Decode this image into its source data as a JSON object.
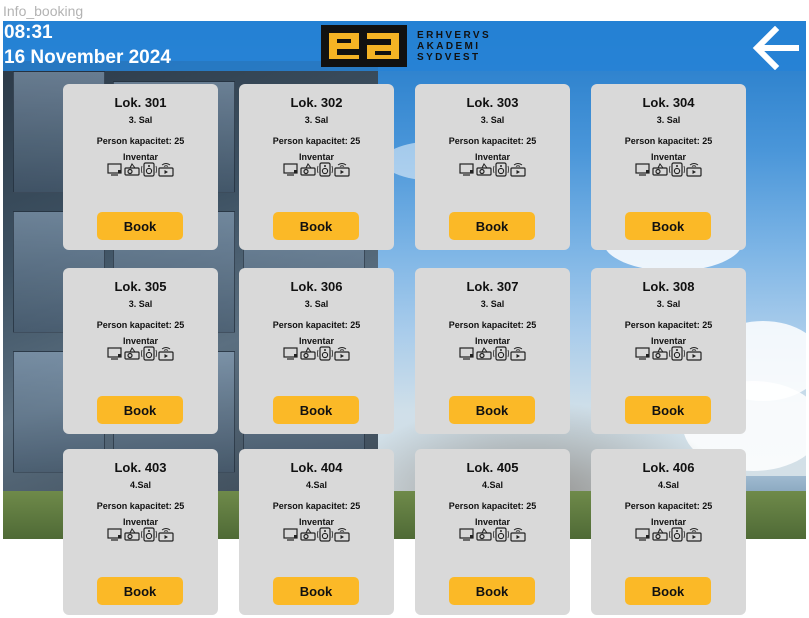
{
  "frame_label": "Info_booking",
  "header": {
    "time": "08:31",
    "date": "16 November 2024",
    "logo": {
      "mark": "ea",
      "lines": [
        "ERHVERVS",
        "AKADEMI",
        "SYDVEST"
      ]
    },
    "back_icon": "arrow-left-icon"
  },
  "colors": {
    "header_bar": "#2682d6",
    "card_background": "#d9d9d9",
    "book_button": "#fbb927",
    "logo_accent": "#f5b324"
  },
  "inventory_icons": [
    "screen-icon",
    "projector-icon",
    "speaker-icon",
    "camera-icon"
  ],
  "rooms": [
    {
      "name": "Lok. 301",
      "floor": "3. Sal",
      "capacity": "Person kapacitet: 25",
      "inventory_label": "Inventar",
      "button": "Book"
    },
    {
      "name": "Lok. 302",
      "floor": "3. Sal",
      "capacity": "Person kapacitet: 25",
      "inventory_label": "Inventar",
      "button": "Book"
    },
    {
      "name": "Lok. 303",
      "floor": "3. Sal",
      "capacity": "Person kapacitet: 25",
      "inventory_label": "Inventar",
      "button": "Book"
    },
    {
      "name": "Lok. 304",
      "floor": "3. Sal",
      "capacity": "Person kapacitet: 25",
      "inventory_label": "Inventar",
      "button": "Book"
    },
    {
      "name": "Lok. 305",
      "floor": "3. Sal",
      "capacity": "Person kapacitet: 25",
      "inventory_label": "Inventar",
      "button": "Book"
    },
    {
      "name": "Lok. 306",
      "floor": "3. Sal",
      "capacity": "Person kapacitet: 25",
      "inventory_label": "Inventar",
      "button": "Book"
    },
    {
      "name": "Lok. 307",
      "floor": "3. Sal",
      "capacity": "Person kapacitet: 25",
      "inventory_label": "Inventar",
      "button": "Book"
    },
    {
      "name": "Lok. 308",
      "floor": "3. Sal",
      "capacity": "Person kapacitet: 25",
      "inventory_label": "Inventar",
      "button": "Book"
    },
    {
      "name": "Lok. 403",
      "floor": "4.Sal",
      "capacity": "Person kapacitet: 25",
      "inventory_label": "Inventar",
      "button": "Book"
    },
    {
      "name": "Lok. 404",
      "floor": "4.Sal",
      "capacity": "Person kapacitet: 25",
      "inventory_label": "Inventar",
      "button": "Book"
    },
    {
      "name": "Lok. 405",
      "floor": "4.Sal",
      "capacity": "Person kapacitet: 25",
      "inventory_label": "Inventar",
      "button": "Book"
    },
    {
      "name": "Lok. 406",
      "floor": "4.Sal",
      "capacity": "Person kapacitet: 25",
      "inventory_label": "Inventar",
      "button": "Book"
    }
  ]
}
